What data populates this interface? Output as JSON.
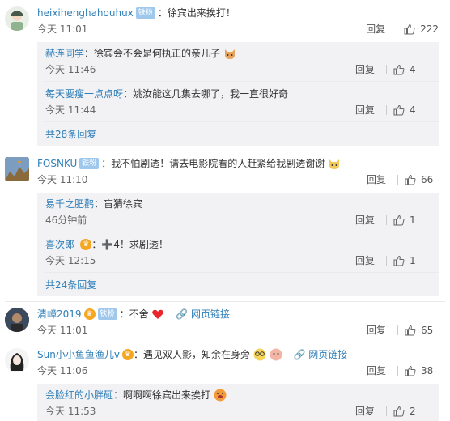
{
  "actions": {
    "reply_label": "回复"
  },
  "comments": [
    {
      "username": "heixihenghahouhux",
      "badge": "铁粉",
      "text": "：徐宾出来挨打！",
      "time": "今天 11:01",
      "likes": "222",
      "replies": [
        {
          "username": "赫连同学",
          "text": "：徐宾会不会是何执正的亲儿子",
          "time": "今天 11:46",
          "likes": "4"
        },
        {
          "username": "每天要瘦一点点呀",
          "text": "：姚汝能这几集去哪了，我一直很好奇",
          "time": "今天 11:44",
          "likes": "4"
        }
      ],
      "more": "共28条回复"
    },
    {
      "username": "FOSNKU",
      "badge": "铁粉",
      "text": "：我不怕剧透！请去电影院看的人赶紧给我剧透谢谢",
      "time": "今天 11:10",
      "likes": "66",
      "replies": [
        {
          "username": "易千之肥鹳",
          "text": "：盲猜徐宾",
          "time": "46分钟前",
          "likes": "1"
        },
        {
          "username": "喜次郎-",
          "text": "：➕4！求剧透！",
          "time": "今天 12:15",
          "likes": "1"
        }
      ],
      "more": "共24条回复"
    },
    {
      "username": "清嶂2019",
      "badge": "铁粉",
      "text": "：不舍",
      "link": "网页链接",
      "time": "今天 11:01",
      "likes": "65"
    },
    {
      "username": "Sun小小鱼鱼渔儿v",
      "text": "：遇见双人影，知余在身旁",
      "link": "网页链接",
      "time": "今天 11:06",
      "likes": "38",
      "replies": [
        {
          "username": "会脸红的小胖砸",
          "text": "：啊啊啊徐宾出来挨打",
          "time": "今天 11:53",
          "likes": "2"
        }
      ]
    }
  ]
}
